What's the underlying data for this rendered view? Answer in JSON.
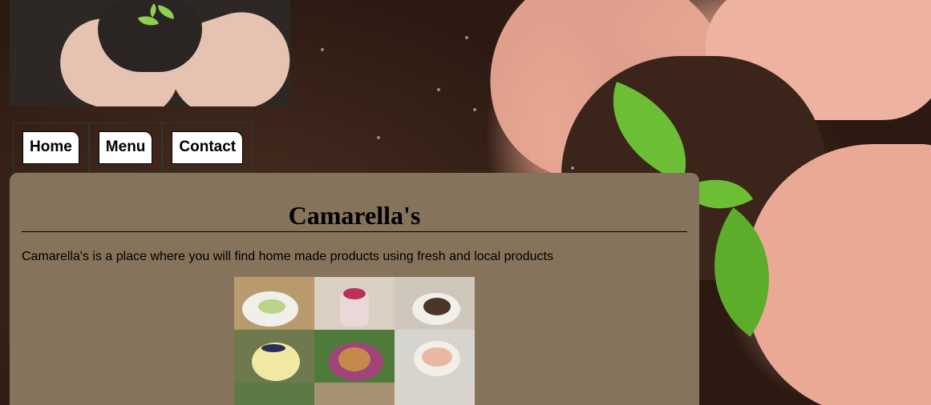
{
  "nav": {
    "items": [
      {
        "label": "Home"
      },
      {
        "label": "Menu"
      },
      {
        "label": "Contact"
      }
    ]
  },
  "main": {
    "title": "Camarella's",
    "description": "Camarella's is a place where you will find home made products using fresh and local products"
  },
  "images": {
    "logo": "hands-holding-soil-heart-with-sprout",
    "background": "hands-holding-soil-with-seedling",
    "collage": "food-dishes-collage"
  },
  "colors": {
    "card_background": "#86735b",
    "button_background": "#ffffff"
  }
}
